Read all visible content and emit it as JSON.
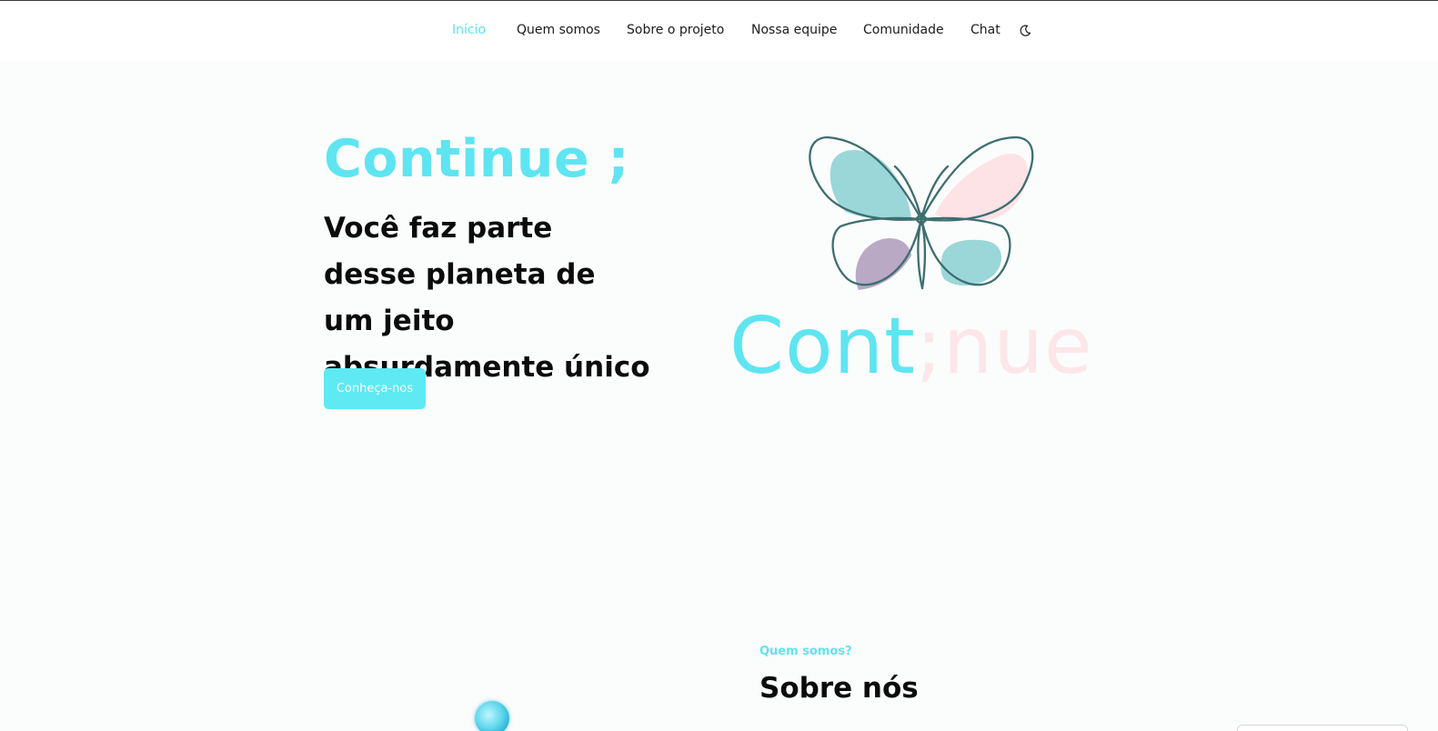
{
  "nav": {
    "items": [
      {
        "label": "Início",
        "active": true
      },
      {
        "label": "Quem somos",
        "active": false
      },
      {
        "label": "Sobre o projeto",
        "active": false
      },
      {
        "label": "Nossa equipe",
        "active": false
      },
      {
        "label": "Comunidade",
        "active": false
      },
      {
        "label": "Chat",
        "active": false
      }
    ],
    "theme_toggle_icon": "moon-icon"
  },
  "hero": {
    "title": "Continue ;",
    "tagline": "Você faz parte desse planeta de um jeito absurdamente único",
    "cta_label": "Conheça-nos"
  },
  "logo": {
    "icon": "butterfly-logo-icon",
    "word_part1": "Cont",
    "word_part2": ";nue"
  },
  "about": {
    "kicker": "Quem somos?",
    "title": "Sobre nós"
  },
  "colors": {
    "accent": "#5ee5f1",
    "text": "#0b0b0b",
    "logo_pink": "#fde6ea",
    "logo_teal_stroke": "#3d6e70",
    "wing_teal": "#9bd7d8",
    "wing_pink": "#fde2e6",
    "wing_purple": "#b9a9c4",
    "background": "#fbfcfc"
  }
}
